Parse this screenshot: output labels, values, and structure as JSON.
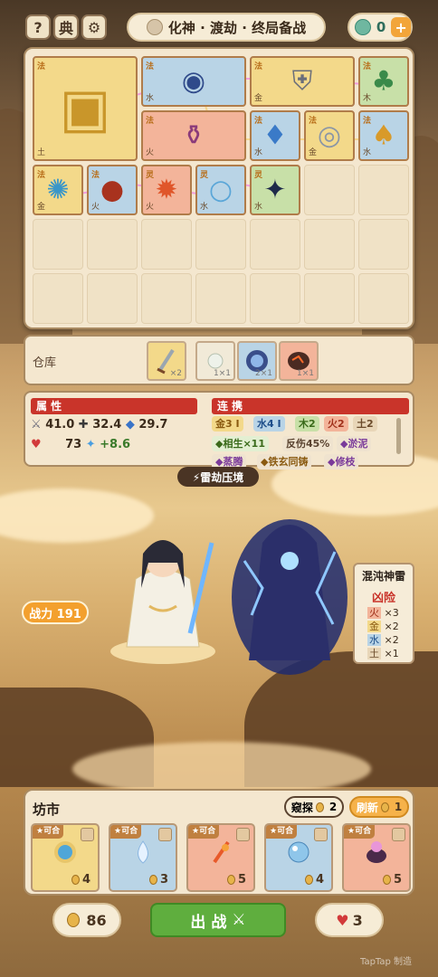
{
  "header": {
    "help": "?",
    "codex": "典",
    "stage_title": "化神 · 渡劫 · 终局备战",
    "currency": "0",
    "plus": "+"
  },
  "board": {
    "items": [
      {
        "el": "法",
        "wx": "土",
        "color": "gold",
        "icon": "golden-cube-icon"
      },
      {
        "el": "法",
        "wx": "水",
        "color": "blue",
        "icon": "blue-gourd-orb-icon"
      },
      {
        "el": "法",
        "wx": "金",
        "color": "gold",
        "icon": "armor-icon"
      },
      {
        "el": "法",
        "wx": "木",
        "color": "green",
        "icon": "green-tree-icon"
      },
      {
        "el": "法",
        "wx": "火",
        "color": "red",
        "icon": "purple-cauldron-icon"
      },
      {
        "el": "法",
        "wx": "水",
        "color": "blue",
        "icon": "water-gourd-icon"
      },
      {
        "el": "法",
        "wx": "金",
        "color": "gold",
        "icon": "silver-bracers-icon"
      },
      {
        "el": "法",
        "wx": "水",
        "color": "blue",
        "icon": "golden-gourd-icon"
      },
      {
        "el": "法",
        "wx": "金",
        "color": "gold",
        "icon": "swirl-disc-icon"
      },
      {
        "el": "法",
        "wx": "火",
        "color": "blue",
        "icon": "red-orb-icon"
      },
      {
        "el": "灵",
        "wx": "火",
        "color": "red",
        "icon": "fire-scroll-icon"
      },
      {
        "el": "灵",
        "wx": "水",
        "color": "blue",
        "icon": "crystal-orb-icon"
      },
      {
        "el": "灵",
        "wx": "水",
        "color": "green",
        "icon": "dark-claw-icon"
      }
    ]
  },
  "warehouse": {
    "label": "仓库",
    "slots": [
      {
        "count": "×2"
      },
      {
        "count": "1×1"
      },
      {
        "count": "2×1"
      },
      {
        "count": "1×1"
      }
    ]
  },
  "attributes": {
    "header": "属 性",
    "atk": "41.0",
    "def_plus": "32.4",
    "shield": "29.7",
    "hp": "73",
    "regen": "+8.6"
  },
  "synergy": {
    "header": "连 携",
    "tags": [
      "金3 I",
      "水4 I",
      "木2",
      "火2",
      "土2",
      "◆相生×11",
      "反伤45%",
      "◆淤泥",
      "◆蒸腾",
      "◆铁玄同铸",
      "◆修枝"
    ]
  },
  "banner": "⚡雷劫压境",
  "player": {
    "power": "战力 191"
  },
  "enemy": {
    "name": "混沌神雷",
    "danger": "凶险",
    "elements": [
      {
        "el": "火",
        "count": "×3"
      },
      {
        "el": "金",
        "count": "×2"
      },
      {
        "el": "水",
        "count": "×2"
      },
      {
        "el": "土",
        "count": "×1"
      }
    ]
  },
  "shop": {
    "title": "坊市",
    "peek": "窥探",
    "peek_cost": "2",
    "refresh": "刷新",
    "refresh_cost": "1",
    "cards": [
      {
        "tag": "★可合",
        "price": "4"
      },
      {
        "tag": "★可合",
        "price": "3"
      },
      {
        "tag": "★可合",
        "price": "5"
      },
      {
        "tag": "★可合",
        "price": "4"
      },
      {
        "tag": "★可合",
        "price": "5"
      }
    ]
  },
  "footer": {
    "gold": "86",
    "fight": "出 战",
    "lives": "3"
  },
  "watermark": "TapTap 制造"
}
